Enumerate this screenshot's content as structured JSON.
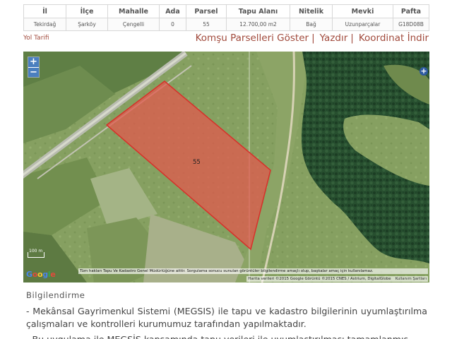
{
  "parcel_table": {
    "headers": [
      "İl",
      "İlçe",
      "Mahalle",
      "Ada",
      "Parsel",
      "Tapu Alanı",
      "Nitelik",
      "Mevki",
      "Pafta"
    ],
    "row": [
      "Tekirdağ",
      "Şarköy",
      "Çengelli",
      "0",
      "55",
      "12.700,00 m2",
      "Bağ",
      "Uzunparçalar",
      "G18D08B"
    ]
  },
  "links": {
    "route": "Yol Tarifi",
    "neighbors": "Komşu Parselleri Göster",
    "print": "Yazdır",
    "coords": "Koordinat İndir",
    "separator": "|"
  },
  "map": {
    "zoom_in": "+",
    "zoom_out": "−",
    "expand": "+",
    "parcel_label": "55",
    "scale_text": "100 m",
    "google_logo": [
      "G",
      "o",
      "o",
      "g",
      "l",
      "e"
    ],
    "disclaimer": "Tüm hakları Tapu Ve Kadastro Genel Müdürlüğüne aittir. Sorgulama sonucu sunulan görüntüler bilgilendirme amaçlı olup, başkalar amaç için kullanılamaz.",
    "attribution": "Harita verileri ©2015 Google Görüntü ©2015 CNES / Astrium, DigitalGlobe",
    "terms": "Kullanım Şartları",
    "colors": {
      "parcel_fill": "#e4564c",
      "parcel_stroke": "#d8302a",
      "forest": "#274f2f",
      "field": "#8fa868"
    }
  },
  "info": {
    "title": "Bilgilendirme",
    "paragraph_1": "- Mekânsal Gayrimenkul Sistemi (MEGSIS) ile tapu ve kadastro bilgilerinin uyumlaştırılma çalışmaları ve kontrolleri kurumumuz tarafından yapılmaktadır.",
    "paragraph_2": "- Bu uygulama ile MEGSİS kapsamında tapu verileri ile uyumlaştırılması tamamlanmış"
  }
}
